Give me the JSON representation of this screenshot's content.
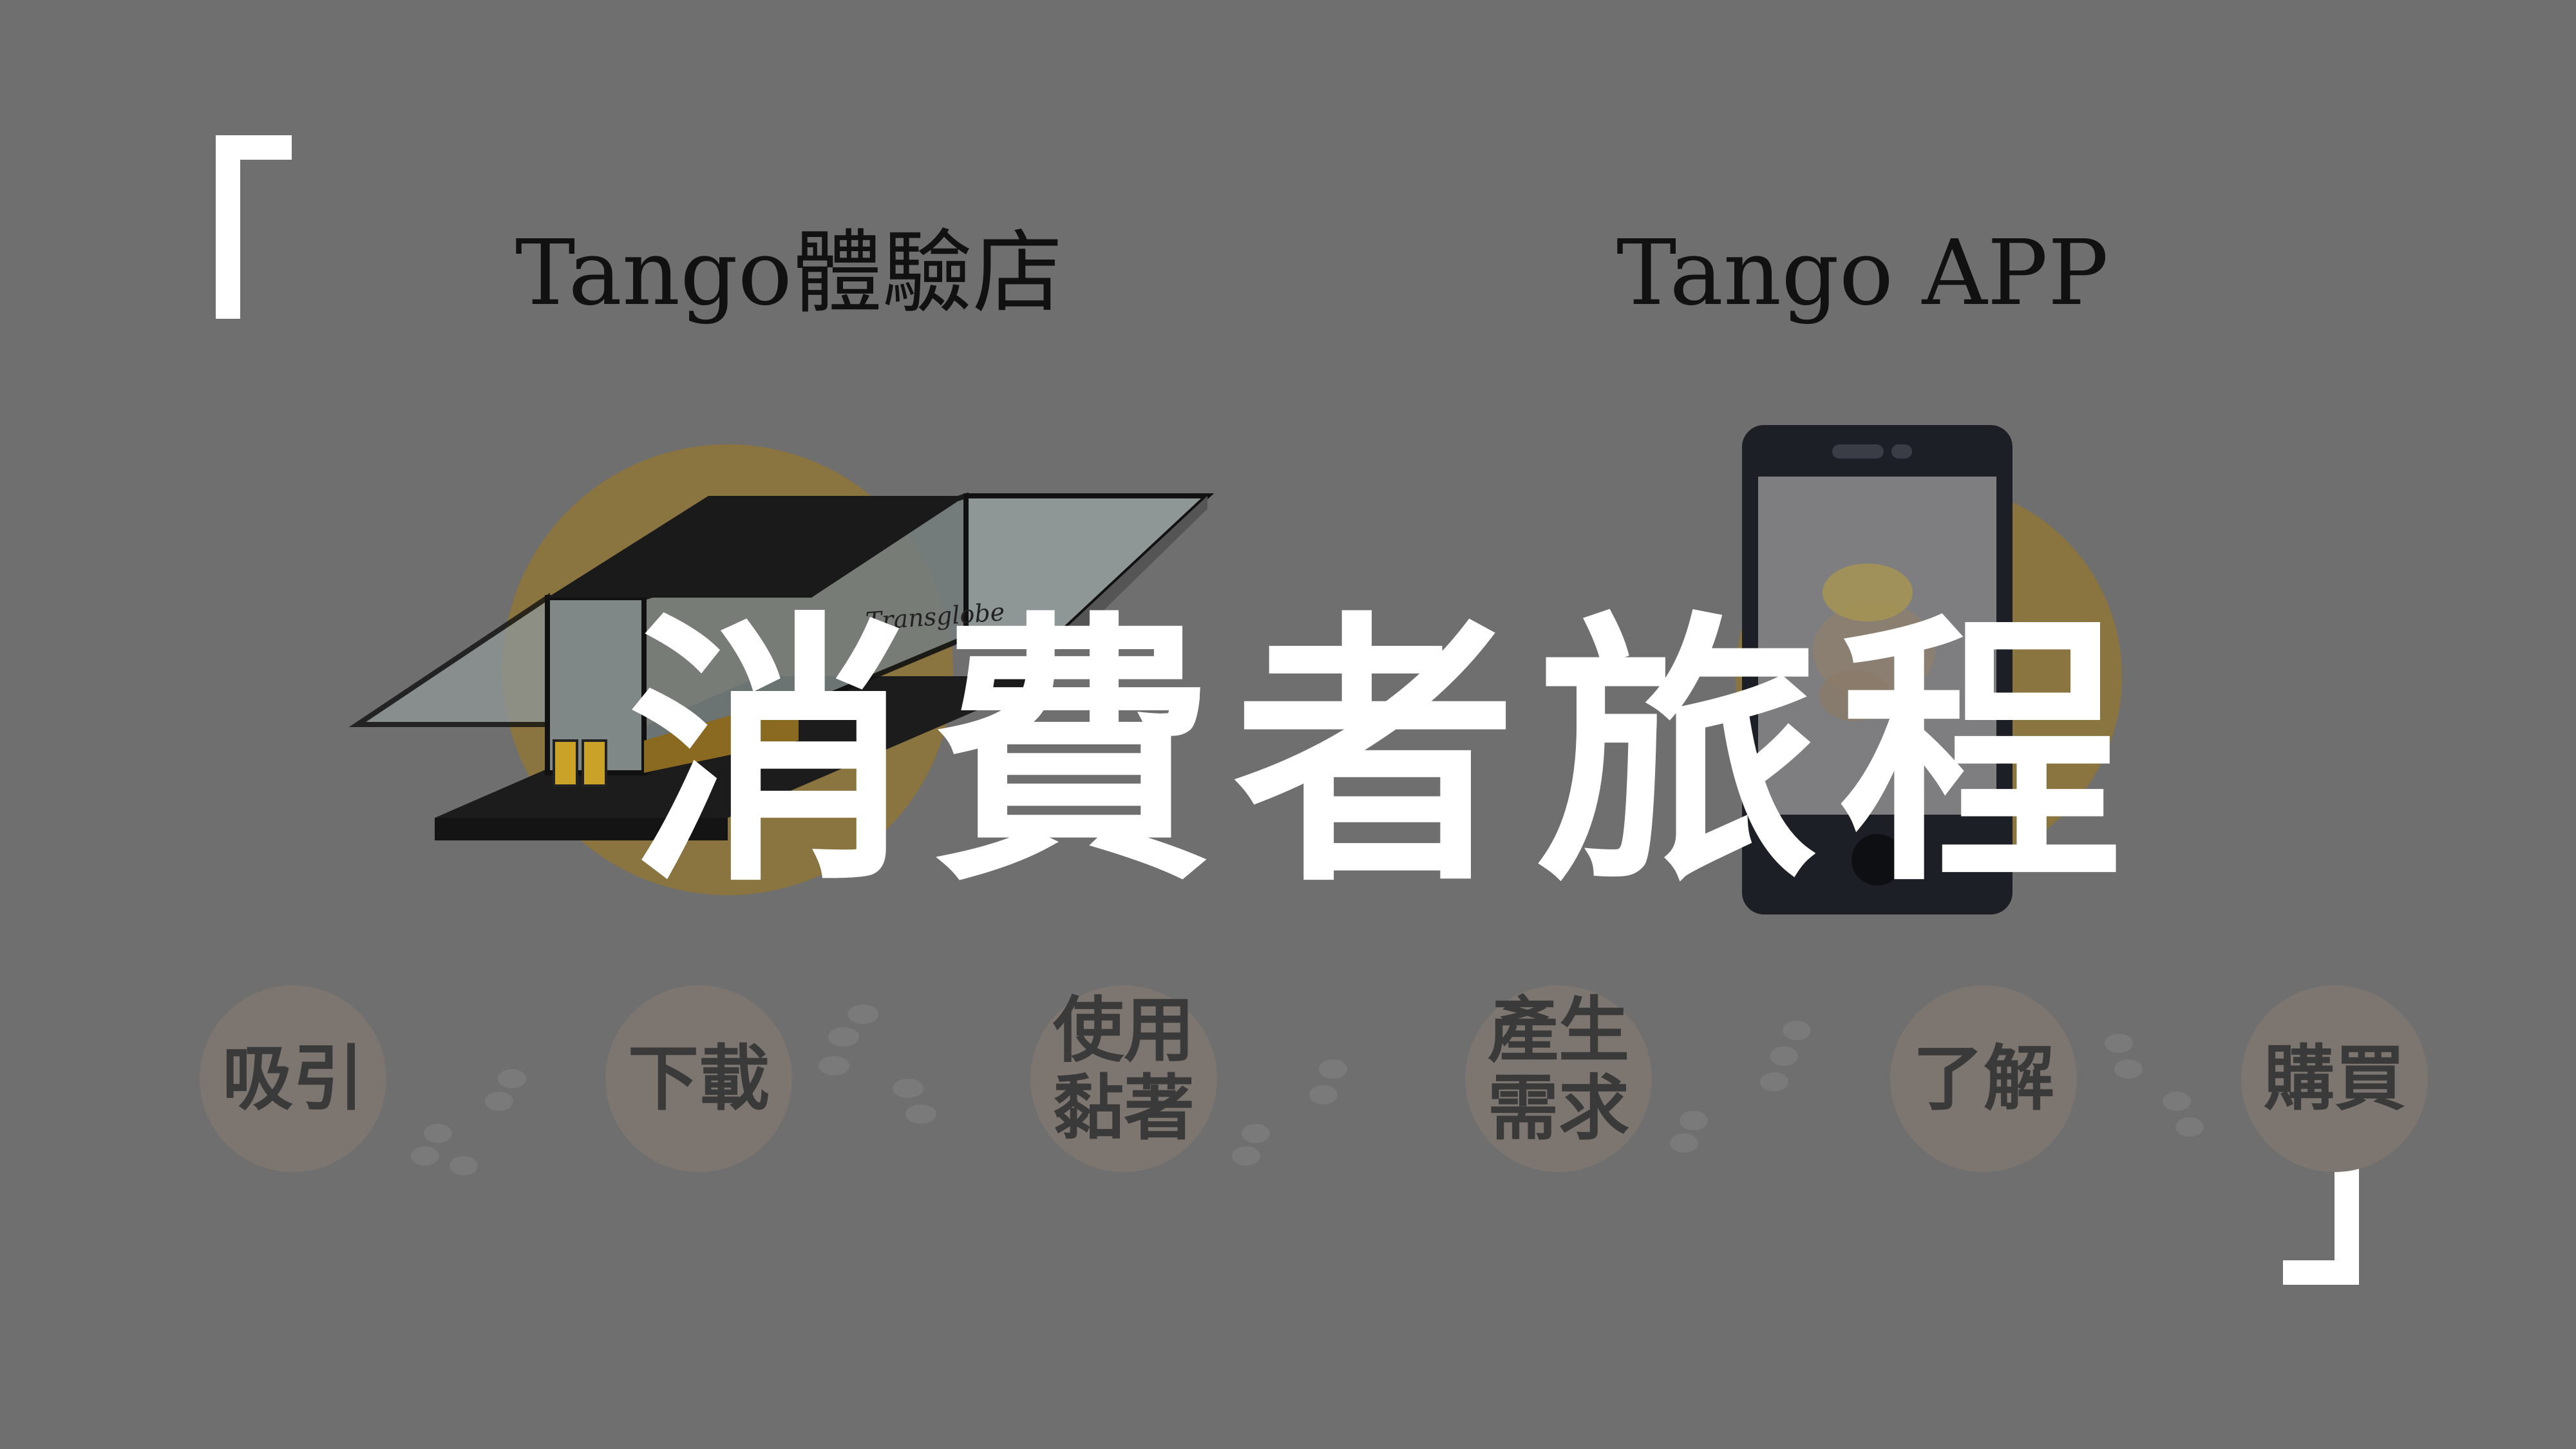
{
  "headings": {
    "store": "Tango體驗店",
    "app": "Tango APP"
  },
  "title": "消費者旅程",
  "store_sign": "Transglobe",
  "steps": [
    {
      "label": "吸引"
    },
    {
      "label": "下載"
    },
    {
      "label": "使用\n黏著"
    },
    {
      "label": "產生\n需求"
    },
    {
      "label": "了解"
    },
    {
      "label": "購買"
    }
  ],
  "colors": {
    "background": "#6f6f6f",
    "accent_gold": "#8a7440",
    "bracket": "#ffffff",
    "title": "#ffffff"
  }
}
